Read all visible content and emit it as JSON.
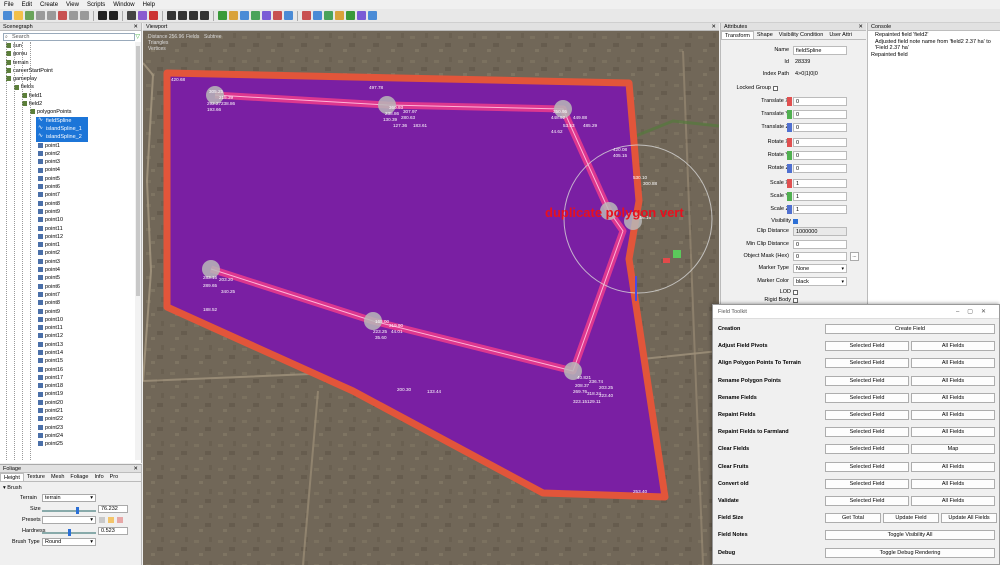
{
  "menu": [
    "File",
    "Edit",
    "Create",
    "View",
    "Scripts",
    "Window",
    "Help"
  ],
  "scenegraph": {
    "title": "Scenegraph",
    "search_placeholder": "Search",
    "items": [
      {
        "label": "sun",
        "depth": 1
      },
      {
        "label": "gorou",
        "depth": 1
      },
      {
        "label": "terrain",
        "depth": 1
      },
      {
        "label": "careerStartPoint",
        "depth": 1
      },
      {
        "label": "gameplay",
        "depth": 1
      },
      {
        "label": "fields",
        "depth": 2
      },
      {
        "label": "field1",
        "depth": 3
      },
      {
        "label": "field2",
        "depth": 3
      },
      {
        "label": "polygonPoints",
        "depth": 4
      },
      {
        "label": "fieldSpline",
        "depth": 5,
        "sel": true
      },
      {
        "label": "islandSpline_1",
        "depth": 5,
        "sel": true
      },
      {
        "label": "islandSpline_2",
        "depth": 5,
        "sel": true
      },
      {
        "label": "point1",
        "depth": 5
      },
      {
        "label": "point2",
        "depth": 5
      },
      {
        "label": "point3",
        "depth": 5
      },
      {
        "label": "point4",
        "depth": 5
      },
      {
        "label": "point5",
        "depth": 5
      },
      {
        "label": "point6",
        "depth": 5
      },
      {
        "label": "point7",
        "depth": 5
      },
      {
        "label": "point8",
        "depth": 5
      },
      {
        "label": "point9",
        "depth": 5
      },
      {
        "label": "point10",
        "depth": 5
      },
      {
        "label": "point11",
        "depth": 5
      },
      {
        "label": "point12",
        "depth": 5
      },
      {
        "label": "point1",
        "depth": 5
      },
      {
        "label": "point2",
        "depth": 5
      },
      {
        "label": "point3",
        "depth": 5
      },
      {
        "label": "point4",
        "depth": 5
      },
      {
        "label": "point5",
        "depth": 5
      },
      {
        "label": "point6",
        "depth": 5
      },
      {
        "label": "point7",
        "depth": 5
      },
      {
        "label": "point8",
        "depth": 5
      },
      {
        "label": "point9",
        "depth": 5
      },
      {
        "label": "point10",
        "depth": 5
      },
      {
        "label": "point11",
        "depth": 5
      },
      {
        "label": "point12",
        "depth": 5
      },
      {
        "label": "point13",
        "depth": 5
      },
      {
        "label": "point14",
        "depth": 5
      },
      {
        "label": "point15",
        "depth": 5
      },
      {
        "label": "point16",
        "depth": 5
      },
      {
        "label": "point17",
        "depth": 5
      },
      {
        "label": "point18",
        "depth": 5
      },
      {
        "label": "point19",
        "depth": 5
      },
      {
        "label": "point20",
        "depth": 5
      },
      {
        "label": "point21",
        "depth": 5
      },
      {
        "label": "point22",
        "depth": 5
      },
      {
        "label": "point23",
        "depth": 5
      },
      {
        "label": "point24",
        "depth": 5
      },
      {
        "label": "point25",
        "depth": 5
      }
    ]
  },
  "foliage": {
    "title": "Foliage",
    "tabs": [
      "Height",
      "Texture",
      "Mesh",
      "Foliage",
      "Info",
      "Pro"
    ],
    "section": "Brush",
    "terrain_label": "Terrain",
    "terrain_value": "terrain",
    "size_label": "Size",
    "size_value": "76.232",
    "presets_label": "Presets",
    "hardness_label": "Hardness",
    "hardness_value": "0.523",
    "brush_type_label": "Brush Type",
    "brush_type_value": "Round"
  },
  "viewport": {
    "title": "Viewport",
    "stats_lines": [
      "Distance 256.96",
      "Triangles",
      "Vertices"
    ],
    "stats_right": [
      "Fields",
      "Subtree"
    ],
    "overlay_text": "duplicate polygon vert",
    "annotations": [
      "420.68",
      "497.78",
      "305.25",
      "215.39",
      "292.27",
      "238.86",
      "193.66",
      "360.93",
      "307.97",
      "238.86",
      "130.39",
      "280.63",
      "127.36",
      "183.61",
      "350.95",
      "448.92",
      "449.88",
      "53.53",
      "485.29",
      "44.62",
      "420.08",
      "405.15",
      "530.10",
      "300.88",
      "256.16",
      "283.16",
      "203.20",
      "289.65",
      "340.25",
      "165.00",
      "319.90",
      "223.25",
      "44.01",
      "35.60",
      "40.821",
      "236.74",
      "208.37",
      "203.25",
      "269.76",
      "318.24",
      "223.40",
      "323.15",
      "129.11",
      "188.52",
      "253.40",
      "200.30",
      "133.44"
    ]
  },
  "attributes": {
    "title": "Attributes",
    "tabs": [
      "Transform",
      "Shape",
      "Visibility Condition",
      "User Attri"
    ],
    "name_label": "Name",
    "name_value": "fieldSpline",
    "id_label": "Id",
    "id_value": "28339",
    "index_label": "Index Path",
    "index_value": "4>0|1|0|0",
    "locked_label": "Locked Group",
    "tx_label": "Translate X",
    "tx_value": "0",
    "ty_label": "Translate Y",
    "ty_value": "0",
    "tz_label": "Translate Z",
    "tz_value": "0",
    "rx_label": "Rotate X",
    "rx_value": "0",
    "ry_label": "Rotate Y",
    "ry_value": "0",
    "rz_label": "Rotate Z",
    "rz_value": "0",
    "sx_label": "Scale X",
    "sx_value": "1",
    "sy_label": "Scale Y",
    "sy_value": "1",
    "sz_label": "Scale Z",
    "sz_value": "1",
    "visibility_label": "Visibility",
    "clip_label": "Clip Distance",
    "clip_value": "1000000",
    "minclip_label": "Min Clip Distance",
    "minclip_value": "0",
    "mask_label": "Object Mask (Hex)",
    "mask_value": "0",
    "marker_type_label": "Marker Type",
    "marker_type_value": "None",
    "marker_color_label": "Marker Color",
    "marker_color_value": "black",
    "lod_label": "LOD",
    "rigid_label": "Rigid Body"
  },
  "console": {
    "title": "Console",
    "lines": [
      "Repainted field 'field2'",
      "Adjusted field note name from 'field2 2.37 ha' to 'Field 2.37 ha'",
      "Repainted field"
    ]
  },
  "toolkit": {
    "title": "Field Toolkit",
    "rows": [
      {
        "label": "Creation",
        "buttons": [
          "Create Field"
        ]
      },
      {
        "label": "Adjust Field Pivots",
        "buttons": [
          "Selected Field",
          "All Fields"
        ]
      },
      {
        "label": "Align Polygon Points To Terrain",
        "buttons": [
          "Selected Field",
          "All Fields"
        ]
      },
      {
        "label": "Rename Polygon Points",
        "buttons": [
          "Selected Field",
          "All Fields"
        ]
      },
      {
        "label": "Rename Fields",
        "buttons": [
          "Selected Field",
          "All Fields"
        ]
      },
      {
        "label": "Repaint Fields",
        "buttons": [
          "Selected Field",
          "All Fields"
        ]
      },
      {
        "label": "Repaint Fields to Farmland",
        "buttons": [
          "Selected Field",
          "All Fields"
        ]
      },
      {
        "label": "Clear Fields",
        "buttons": [
          "Selected Field",
          "Map"
        ]
      },
      {
        "label": "Clear Fruits",
        "buttons": [
          "Selected Field",
          "All Fields"
        ]
      },
      {
        "label": "Convert old",
        "buttons": [
          "Selected Field",
          "All Fields"
        ]
      },
      {
        "label": "Validate",
        "buttons": [
          "Selected Field",
          "All Fields"
        ]
      },
      {
        "label": "Field Size",
        "buttons": [
          "Get Total",
          "Update Field",
          "Update All Fields"
        ]
      },
      {
        "label": "Field Notes",
        "buttons": [
          "Toggle Visibility All"
        ]
      },
      {
        "label": "Debug",
        "buttons": [
          "Toggle Debug Rendering"
        ]
      }
    ]
  },
  "colors": {
    "field_fill": "#7a1fa3",
    "field_outline": "#e2553a",
    "island_fill": "#e83a8d",
    "selection": "#1c75d8",
    "overlay_text": "#e8101e"
  }
}
